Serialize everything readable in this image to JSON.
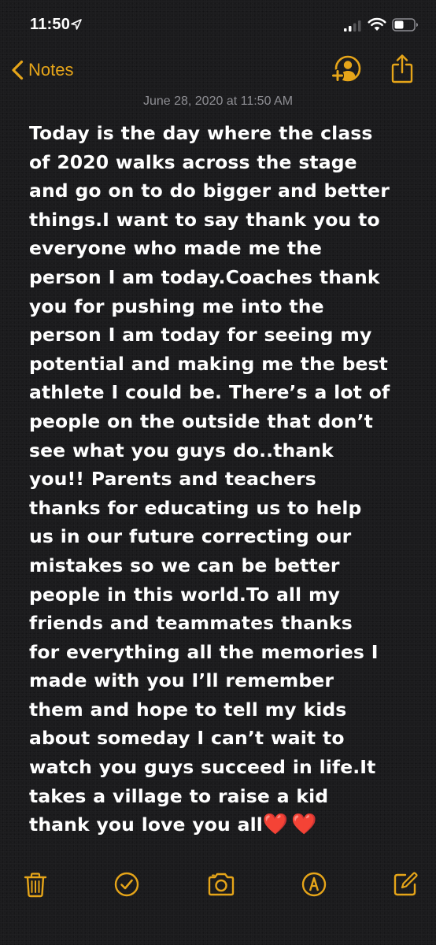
{
  "status_bar": {
    "time": "11:50",
    "location_icon": "location-arrow-icon",
    "signal_icon": "cellular-signal-icon",
    "wifi_icon": "wifi-icon",
    "battery_icon": "battery-icon"
  },
  "nav": {
    "back_label": "Notes",
    "back_icon": "chevron-left-icon",
    "add_people_icon": "add-people-icon",
    "share_icon": "share-icon"
  },
  "note": {
    "date": "June 28, 2020 at 11:50 AM",
    "lines": [
      "Today is the day where the class",
      "of 2020 walks across the stage",
      "and go on to do bigger and better",
      "things.I want to say thank you to",
      "everyone who made me the",
      "person I am today.Coaches thank",
      "you for pushing me into the",
      "person I am today for seeing my",
      "potential and making me the best",
      "athlete I could be. There’s a lot of",
      "people on the outside that don’t",
      "see what you guys do..thank",
      "you!! Parents and teachers",
      "thanks for educating us to help",
      "us in our future correcting our",
      "mistakes so we can be better",
      "people in this world.To all my",
      "friends and teammates thanks",
      "for everything all the memories I",
      "made with you I’ll remember",
      "them and hope to tell my kids",
      "about someday I can’t wait to",
      "watch you guys succeed in life.It",
      "takes a village to raise a kid",
      "thank you love you all"
    ],
    "hearts": "❤️❤️"
  },
  "toolbar": {
    "items": [
      "trash-icon",
      "checklist-icon",
      "camera-icon",
      "markup-icon",
      "compose-icon"
    ]
  },
  "colors": {
    "accent": "#e6a519",
    "background": "#1b1b1d",
    "text": "#ffffff",
    "secondary_text": "#8e8e93",
    "heart": "#e0302b"
  }
}
